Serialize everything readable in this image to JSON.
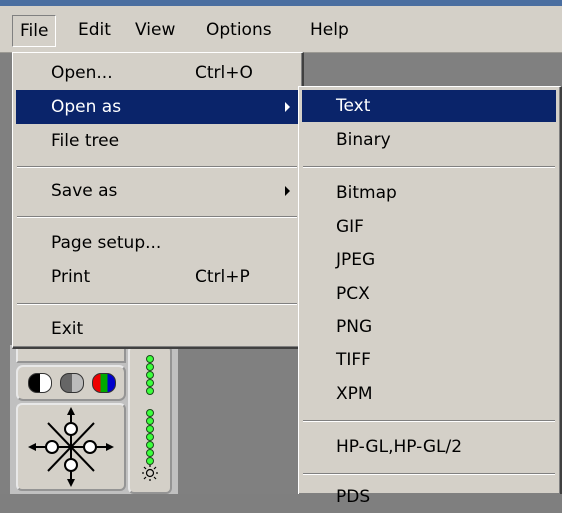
{
  "menubar": {
    "items": [
      "File",
      "Edit",
      "View",
      "Options",
      "Help"
    ]
  },
  "file_menu": {
    "items": [
      {
        "label": "Open...",
        "shortcut": "Ctrl+O"
      },
      {
        "label": "Open as",
        "submenu": true,
        "highlighted": true
      },
      {
        "label": "File tree"
      },
      {
        "label": "Save as",
        "submenu": true
      },
      {
        "label": "Page setup..."
      },
      {
        "label": "Print",
        "shortcut": "Ctrl+P"
      },
      {
        "label": "Exit"
      }
    ]
  },
  "open_as_submenu": {
    "items": [
      "Text",
      "Binary",
      "Bitmap",
      "GIF",
      "JPEG",
      "PCX",
      "PNG",
      "TIFF",
      "XPM",
      "HP-GL,HP-GL/2",
      "PDS"
    ],
    "highlighted": "Text"
  },
  "colors": {
    "highlight": "#0a246a",
    "menu_bg": "#d4d0c8",
    "workspace_bg": "#808080"
  }
}
